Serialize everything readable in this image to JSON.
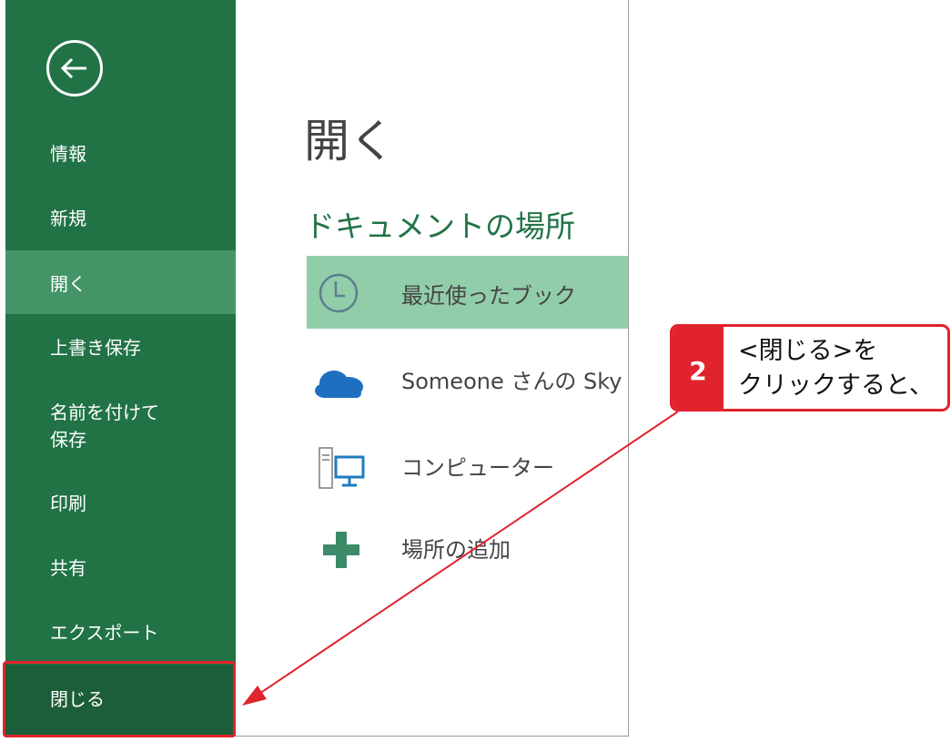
{
  "sidebar": {
    "back_icon": "arrow-left-circle-icon",
    "items": [
      {
        "label": "情報"
      },
      {
        "label": "新規"
      },
      {
        "label": "開く"
      },
      {
        "label": "上書き保存"
      },
      {
        "label": "名前を付けて"
      },
      {
        "label": "保存"
      },
      {
        "label": "印刷"
      },
      {
        "label": "共有"
      },
      {
        "label": "エクスポート"
      },
      {
        "label": "閉じる"
      }
    ]
  },
  "main": {
    "title": "開く",
    "section_heading": "ドキュメントの場所",
    "locations": [
      {
        "label": "最近使ったブック",
        "icon": "clock-icon"
      },
      {
        "label": "Someone さんの Sky",
        "icon": "cloud-icon"
      },
      {
        "label": "コンピューター",
        "icon": "computer-icon"
      },
      {
        "label": "場所の追加",
        "icon": "plus-icon"
      }
    ]
  },
  "callout": {
    "number": "2",
    "line1": "<閉じる>を",
    "line2": "クリックすると、"
  },
  "colors": {
    "sidebar": "#217346",
    "active": "#439467",
    "selected_location": "#92cdaa",
    "callout_red": "#e0232c"
  }
}
